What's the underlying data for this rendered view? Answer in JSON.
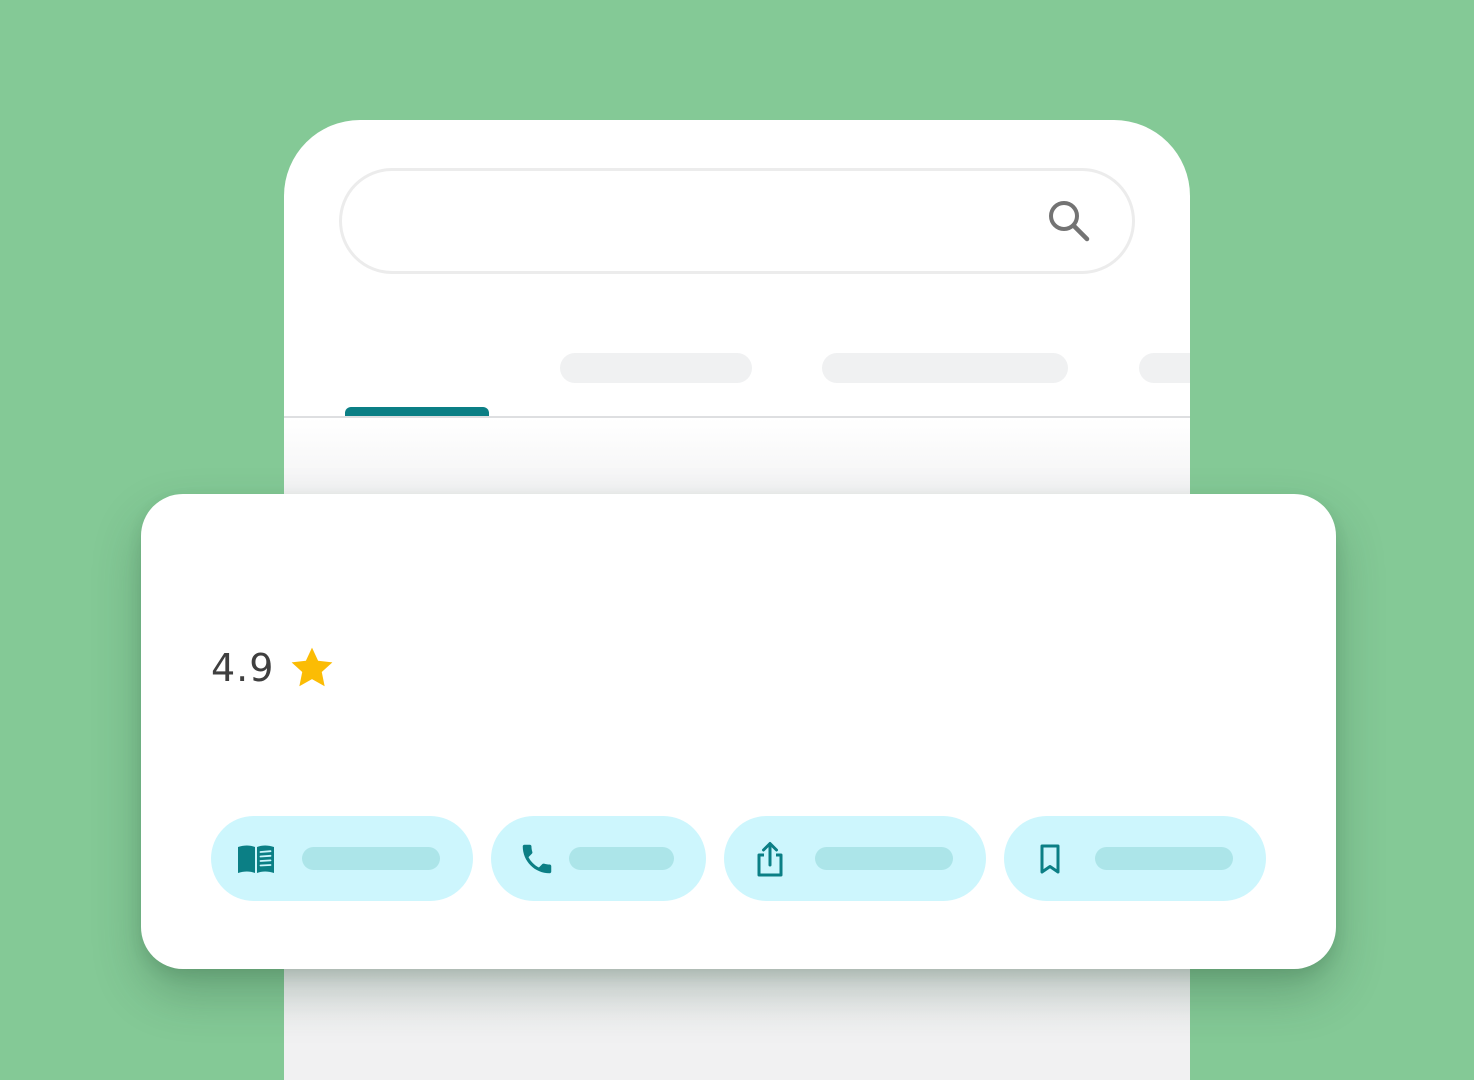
{
  "place": {
    "rating": "4.9"
  },
  "colors": {
    "background": "#84c996",
    "accent": "#0b7f85",
    "chip_fill": "#cdf6fd",
    "star": "#fbbc04"
  },
  "icons": {
    "search": "search-icon",
    "rating": "star-icon",
    "actions": [
      "menu-book-icon",
      "phone-icon",
      "share-icon",
      "bookmark-icon"
    ]
  }
}
